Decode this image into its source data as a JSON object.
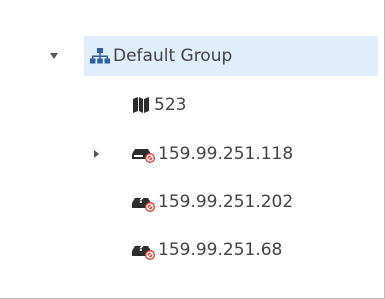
{
  "tree": {
    "root": {
      "label": "Default Group",
      "icon": "network-group-icon",
      "expanded": true
    },
    "children": [
      {
        "label": "523",
        "icon": "map-icon",
        "expandable": false
      },
      {
        "label": "159.99.251.118",
        "icon": "device-disabled-icon",
        "expandable": true,
        "expanded": false
      },
      {
        "label": "159.99.251.202",
        "icon": "device-unknown-disabled-icon",
        "expandable": false
      },
      {
        "label": "159.99.251.68",
        "icon": "device-unknown-disabled-icon",
        "expandable": false
      }
    ]
  },
  "colors": {
    "selection": "#dfeefa",
    "icon_blue": "#2b5fa8",
    "icon_dark": "#2d2d2d",
    "alert_red": "#e53935",
    "border": "#bdbdbd"
  }
}
